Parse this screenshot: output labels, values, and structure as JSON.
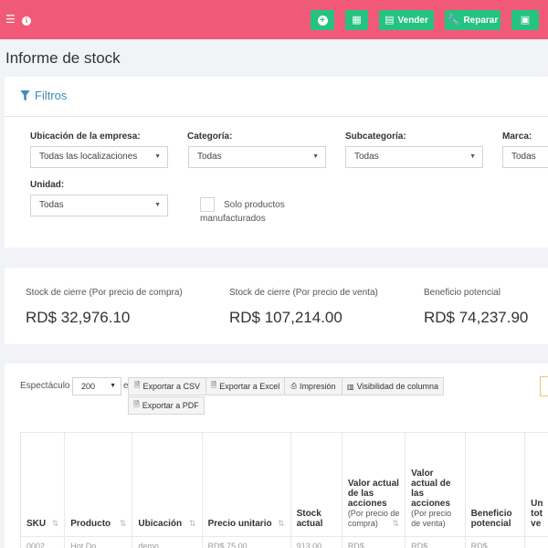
{
  "header": {
    "menu_icon": "hamburger-icon",
    "info_icon": "info-circle-icon",
    "buttons": [
      {
        "icon": "plus-circle-icon",
        "label": ""
      },
      {
        "icon": "calculator-icon",
        "label": ""
      },
      {
        "icon": "list-icon",
        "label": "Vender"
      },
      {
        "icon": "wrench-icon",
        "label": "Reparar"
      },
      {
        "icon": "money-icon",
        "label": ""
      }
    ],
    "color": "#f05a78",
    "button_color": "#26c281"
  },
  "page_title": "Informe de stock",
  "filters": {
    "title": "Filtros",
    "location": {
      "label": "Ubicación de la empresa:",
      "value": "Todas las localizaciones"
    },
    "category": {
      "label": "Categoría:",
      "value": "Todas"
    },
    "subcategory": {
      "label": "Subcategoría:",
      "value": "Todas"
    },
    "brand": {
      "label": "Marca:",
      "value": "Todas"
    },
    "unit": {
      "label": "Unidad:",
      "value": "Todas"
    },
    "manufactured": {
      "label": "Solo productos manufacturados",
      "checked": false
    }
  },
  "stats": [
    {
      "label": "Stock de cierre (Por precio de compra)",
      "value": "RD$ 32,976.10"
    },
    {
      "label": "Stock de cierre (Por precio de venta)",
      "value": "RD$ 107,214.00"
    },
    {
      "label": "Beneficio potencial",
      "value": "RD$ 74,237.90"
    }
  ],
  "table": {
    "show_label": "Espectáculo",
    "page_size": "200",
    "after_select": "e",
    "buttons": [
      {
        "icon": "file-csv-icon",
        "label": "Exportar a CSV"
      },
      {
        "icon": "file-excel-icon",
        "label": "Exportar a Excel"
      },
      {
        "icon": "print-icon",
        "label": "Impresión"
      },
      {
        "icon": "columns-icon",
        "label": "Visibilidad de columna"
      },
      {
        "icon": "file-pdf-icon",
        "label": "Exportar a PDF"
      }
    ],
    "columns": [
      {
        "label": "SKU",
        "sub": ""
      },
      {
        "label": "Producto",
        "sub": ""
      },
      {
        "label": "Ubicación",
        "sub": ""
      },
      {
        "label": "Precio unitario",
        "sub": ""
      },
      {
        "label": "Stock actual",
        "sub": ""
      },
      {
        "label": "Valor actual de las acciones",
        "sub": "(Por precio de compra)"
      },
      {
        "label": "Valor actual de las acciones",
        "sub": "(Por precio de venta)"
      },
      {
        "label": "Beneficio potencial",
        "sub": ""
      },
      {
        "label": "Un tot ve",
        "sub": ""
      }
    ],
    "first_row": [
      "0002",
      "Hot Do...",
      "demo",
      "RD$ 75.00",
      "913.00",
      "RD$...",
      "RD$...",
      "RD$...",
      ""
    ]
  }
}
